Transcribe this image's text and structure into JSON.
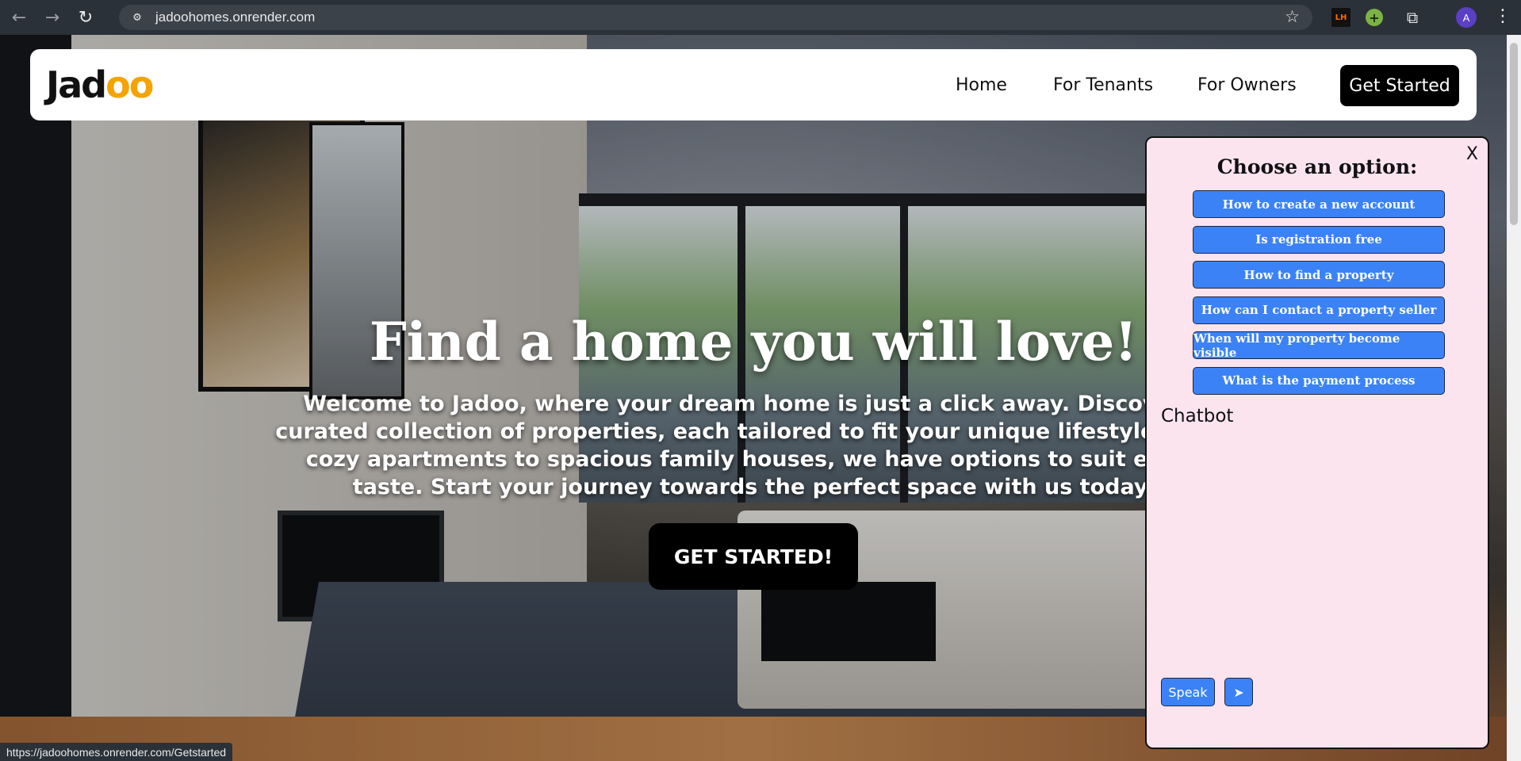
{
  "browser": {
    "back_icon": "←",
    "forward_icon": "→",
    "reload_icon": "↻",
    "site_icon": "⚙",
    "url": "jadoohomes.onrender.com",
    "star_icon": "☆",
    "ext_lh_label": "LH",
    "ext_plus_label": "+",
    "puzzle_icon": "⧉",
    "avatar_letter": "A",
    "menu_icon": "⋮",
    "status_url": "https://jadoohomes.onrender.com/Getstarted"
  },
  "navbar": {
    "logo_prefix": "Jad",
    "logo_suffix": "oo",
    "links": [
      "Home",
      "For Tenants",
      "For Owners"
    ],
    "cta": "Get Started"
  },
  "hero": {
    "title": "Find a home you will love!",
    "text": "Welcome to Jadoo, where your dream home is just a click away. Discover a curated collection of properties, each tailored to fit your unique lifestyle. From cozy apartments to spacious family houses, we have options to suit every taste. Start your journey towards the perfect space with us today.",
    "cta": "GET STARTED!"
  },
  "chatbot": {
    "close": "X",
    "heading": "Choose an option:",
    "options": [
      "How to create a new account",
      "Is registration free",
      "How to find a property",
      "How can I contact a property seller",
      "When will my property become visible",
      "What is the payment process"
    ],
    "label": "Chatbot",
    "speak": "Speak",
    "send_icon": "➤"
  },
  "colors": {
    "accent_blue": "#3b82f6",
    "chat_bg": "#fce4ef",
    "logo_orange": "#f4a300"
  }
}
